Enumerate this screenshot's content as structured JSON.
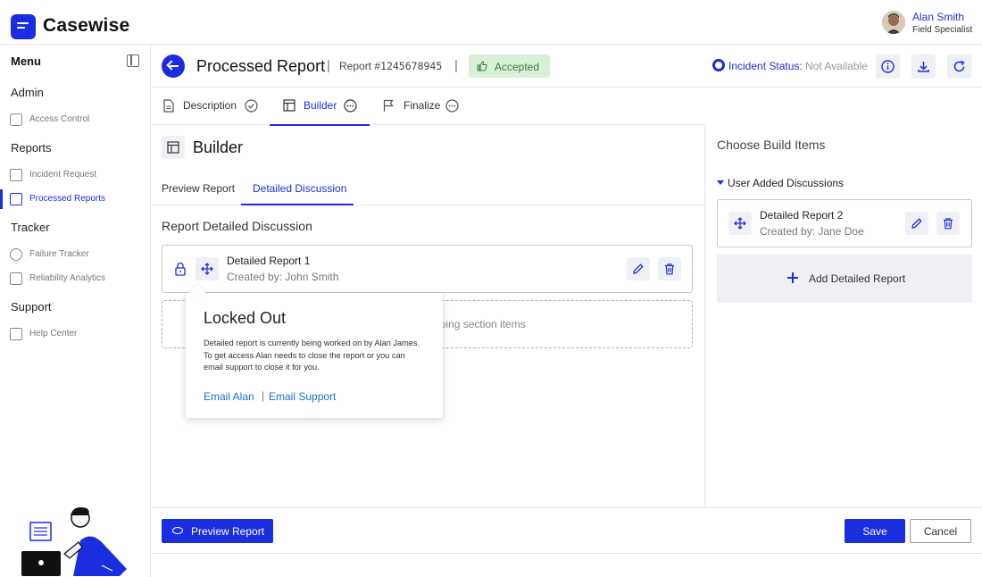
{
  "app": {
    "name": "Casewise"
  },
  "user": {
    "name": "Alan Smith",
    "role": "Field Specialist"
  },
  "sidebar": {
    "menu_title": "Menu",
    "sections": [
      {
        "title": "Admin",
        "items": [
          {
            "label": "Access Control",
            "icon": "lock-icon"
          }
        ]
      },
      {
        "title": "Reports",
        "items": [
          {
            "label": "Incident Request",
            "icon": "incident-icon"
          },
          {
            "label": "Processed Reports",
            "icon": "report-icon",
            "active": true
          }
        ]
      },
      {
        "title": "Tracker",
        "items": [
          {
            "label": "Failure Tracker",
            "icon": "target-icon"
          },
          {
            "label": "Reliability Analytics",
            "icon": "analytics-icon"
          }
        ]
      },
      {
        "title": "Support",
        "items": [
          {
            "label": "Help Center",
            "icon": "help-icon"
          }
        ]
      }
    ]
  },
  "header": {
    "title": "Processed Report",
    "report_label": "Report #",
    "report_number": "1245678945",
    "status_badge": "Accepted",
    "incident_status_label": "Incident Status:",
    "incident_status_value": "Not Available"
  },
  "steps": [
    {
      "label": "Description",
      "state": "done"
    },
    {
      "label": "Builder",
      "state": "active"
    },
    {
      "label": "Finalize",
      "state": "pending"
    }
  ],
  "builder": {
    "title": "Builder",
    "subtabs": [
      "Preview Report",
      "Detailed Discussion"
    ],
    "active_subtab": "Detailed Discussion",
    "section_title": "Report Detailed Discussion",
    "report_card": {
      "name": "Detailed Report 1",
      "created": "Created by: John Smith"
    },
    "dropzone_text": "pping section items"
  },
  "tooltip": {
    "title": "Locked Out",
    "body": "Detailed report is currently being worked on by Alan James. To get access Alan needs to close the report or you can email support to close it for you.",
    "link1": "Email Alan",
    "separator": "|",
    "link2": "Email Support"
  },
  "right_panel": {
    "title": "Choose Build Items",
    "group_label": "User Added Discussions",
    "card": {
      "name": "Detailed Report 2",
      "created": "Created by: Jane Doe"
    },
    "add_label": "Add Detailed Report"
  },
  "footer": {
    "preview": "Preview Report",
    "save": "Save",
    "cancel": "Cancel"
  },
  "colors": {
    "accent": "#1a2ee0",
    "badge_bg": "#d8f0d8",
    "badge_text": "#3b7a3b"
  }
}
